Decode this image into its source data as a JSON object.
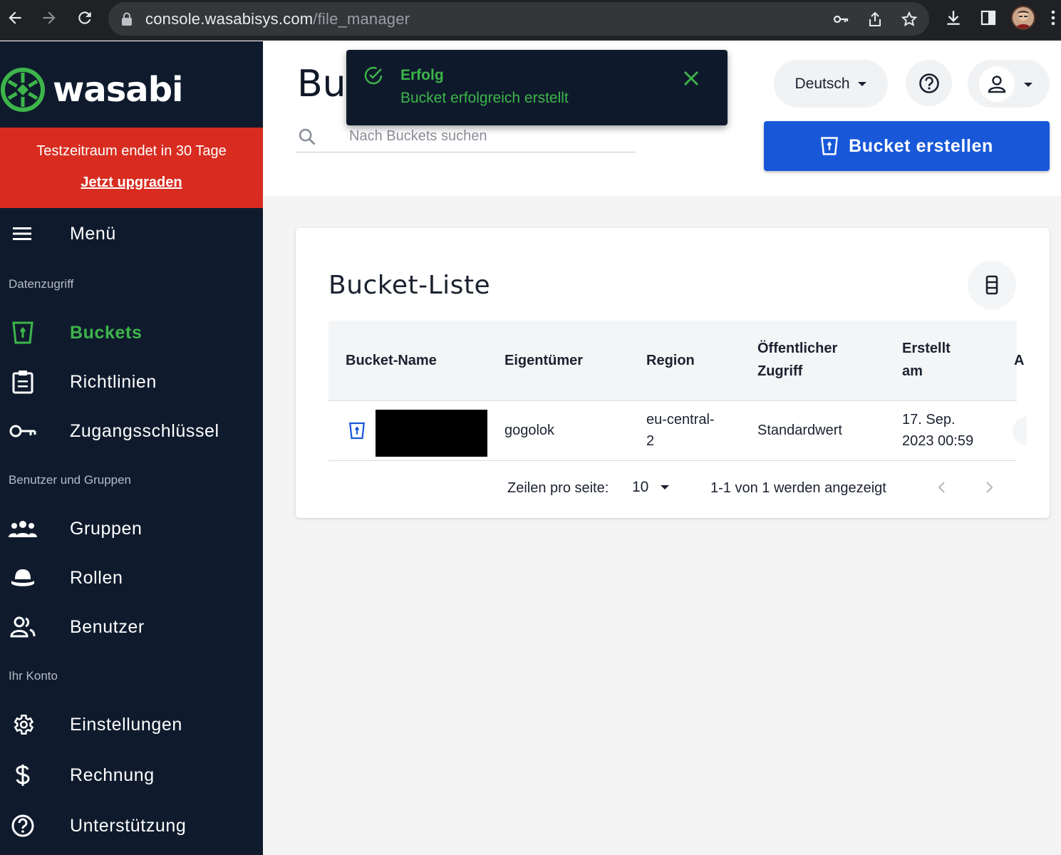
{
  "browser": {
    "url_host": "console.wasabisys.com",
    "url_path": "/file_manager"
  },
  "sidebar": {
    "logo_text": "wasabi",
    "trial": {
      "message": "Testzeitraum endet in 30 Tage",
      "upgrade_link": "Jetzt upgraden"
    },
    "menu_label": "Menü",
    "sections": [
      {
        "title": "Datenzugriff"
      },
      {
        "title": "Benutzer und Gruppen"
      },
      {
        "title": "Ihr Konto"
      }
    ],
    "items": [
      {
        "label": "Buckets",
        "icon": "bucket-icon",
        "active": true
      },
      {
        "label": "Richtlinien",
        "icon": "clipboard-icon"
      },
      {
        "label": "Zugangsschlüssel",
        "icon": "key-icon"
      },
      {
        "label": "Gruppen",
        "icon": "groups-icon"
      },
      {
        "label": "Rollen",
        "icon": "hat-icon"
      },
      {
        "label": "Benutzer",
        "icon": "users-icon"
      },
      {
        "label": "Einstellungen",
        "icon": "gear-icon"
      },
      {
        "label": "Rechnung",
        "icon": "dollar-icon"
      },
      {
        "label": "Unterstützung",
        "icon": "help-icon"
      }
    ]
  },
  "header": {
    "title_partial": "Bu",
    "search_placeholder": "Nach Buckets suchen",
    "language": "Deutsch",
    "create_button": "Bucket erstellen"
  },
  "toast": {
    "title": "Erfolg",
    "message": "Bucket erfolgreich erstellt"
  },
  "bucket_list": {
    "title": "Bucket-Liste",
    "columns": [
      {
        "line1": "Bucket-Name",
        "line2": ""
      },
      {
        "line1": "Eigentümer",
        "line2": ""
      },
      {
        "line1": "Region",
        "line2": ""
      },
      {
        "line1": "Öffentlicher",
        "line2": "Zugriff"
      },
      {
        "line1": "Erstellt",
        "line2": "am"
      },
      {
        "line1": "A",
        "line2": ""
      }
    ],
    "rows": [
      {
        "owner": "gogolok",
        "region_line1": "eu-central-",
        "region_line2": "2",
        "public_access": "Standardwert",
        "created_line1": "17. Sep.",
        "created_line2": "2023 00:59"
      }
    ],
    "pagination": {
      "rows_per_page_label": "Zeilen pro seite:",
      "rows_per_page_value": "10",
      "count_text": "1-1 von 1 werden angezeigt"
    }
  },
  "colors": {
    "sidebar_bg": "#0f1b2d",
    "accent_green": "#3db54a",
    "trial_red": "#d82c20",
    "primary_blue": "#1858d8"
  }
}
